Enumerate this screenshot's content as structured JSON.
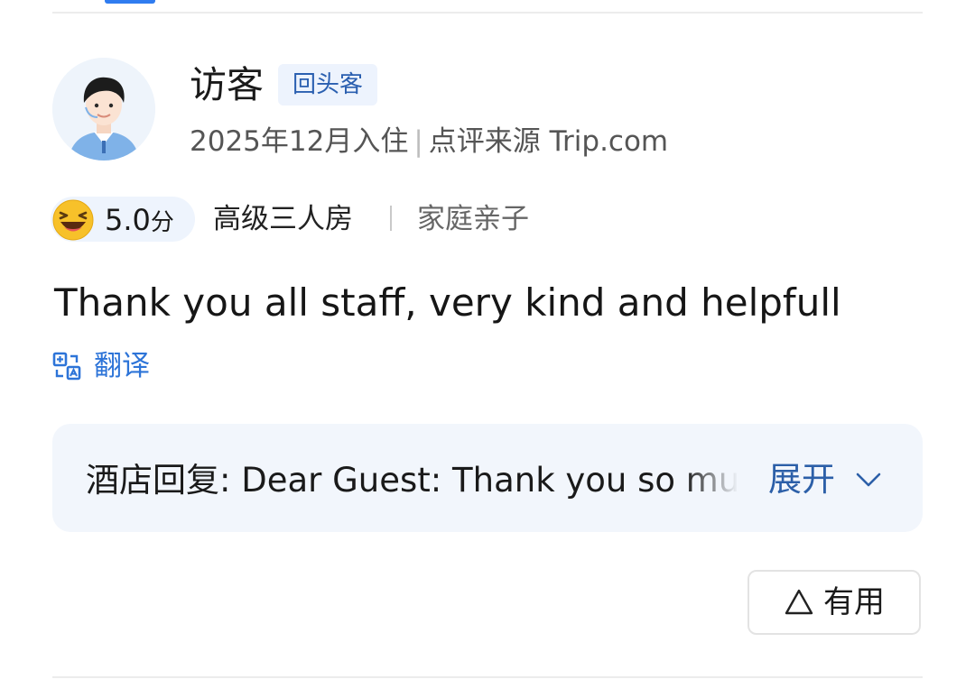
{
  "review": {
    "username": "访客",
    "badge": "回头客",
    "stay_date": "2025年12月入住",
    "source_label": "点评来源 Trip.com",
    "rating": {
      "score": "5.0",
      "unit": "分",
      "icon": "laughing-face-icon"
    },
    "room_type": "高级三人房",
    "trip_type": "家庭亲子",
    "text": "Thank you all staff, very kind and helpfull",
    "translate_label": "翻译",
    "hotel_reply": {
      "text": "酒店回复: Dear Guest: Thank you so much",
      "expand_label": "展开"
    },
    "helpful_label": "有用"
  },
  "colors": {
    "accent_blue": "#2d74d8",
    "badge_bg": "#edf3fd",
    "reply_bg": "#f2f6fc",
    "emoji_yellow": "#f7c12a"
  },
  "icons": {
    "translate": "translate-icon",
    "expand": "chevron-down-icon",
    "helpful": "thumbs-up-outline-icon",
    "avatar": "default-user-avatar"
  }
}
